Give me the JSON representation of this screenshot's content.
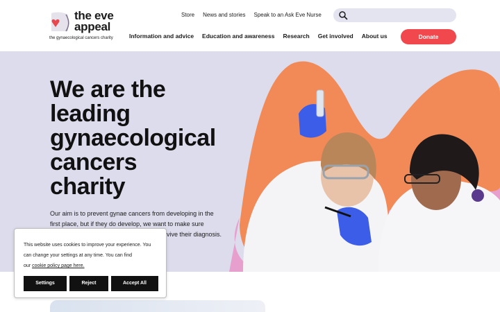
{
  "logo": {
    "title_part1": "the eve",
    "title_part2": "appeal",
    "tagline": "the gynaecological cancers charity"
  },
  "utility_nav": [
    "Store",
    "News and stories",
    "Speak to an Ask Eve Nurse"
  ],
  "search": {
    "icon": "search-icon"
  },
  "main_nav": [
    "Information and advice",
    "Education and awareness",
    "Research",
    "Get involved",
    "About us"
  ],
  "donate_label": "Donate",
  "hero": {
    "title_lines": [
      "We are the",
      "leading",
      "gynaecological",
      "cancers",
      "charity"
    ],
    "text_line1": "Our aim is to prevent gynae cancers from developing in the",
    "text_line2": "first place, but if they do develop, we want to make sure",
    "text_line3": "vive their diagnosis.",
    "image": "two scientists in lab coats examining a test tube"
  },
  "cookie": {
    "text_line1": "This website uses cookies to improve your experience. You",
    "text_line2": "can change your settings at any time. You can find",
    "text_line3_prefix": "our ",
    "link_label": "cookie policy page here.",
    "settings_label": "Settings",
    "reject_label": "Reject",
    "accept_label": "Accept All"
  },
  "colors": {
    "brand_red": "#f0484d",
    "hero_bg": "#dcdcec",
    "orange_shape": "#f28a57",
    "pink_shape": "#e79fcd"
  }
}
